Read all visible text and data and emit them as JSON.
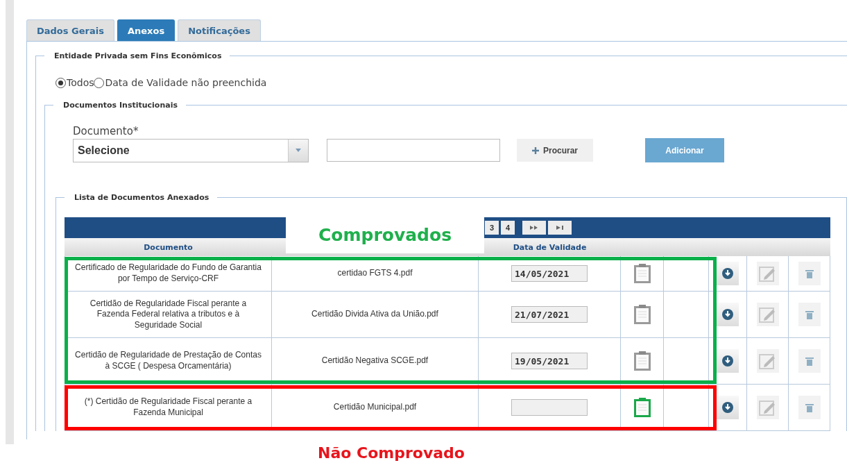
{
  "tabs": [
    {
      "label": "Dados Gerais",
      "selected": false
    },
    {
      "label": "Anexos",
      "selected": true
    },
    {
      "label": "Notificações",
      "selected": false
    }
  ],
  "entity_section": {
    "title": "Entidade Privada sem Fins Econômicos",
    "filter": [
      {
        "label": "Todos",
        "selected": true
      },
      {
        "label": "Data de Validade não preenchida",
        "selected": false
      }
    ]
  },
  "documents_section": {
    "title": "Documentos Institucionais",
    "document_label": "Documento*",
    "document_select": "Selecione",
    "browse_button": "Procurar",
    "add_button": "Adicionar"
  },
  "list_section": {
    "title": "Lista de Documentos Anexados",
    "pager": [
      "3",
      "4"
    ],
    "columns": [
      "Documento",
      "Data de Validade"
    ],
    "rows": [
      {
        "document": "Certificado de Regularidade do Fundo de Garantia por Tempo de Serviço-CRF",
        "file": "certidao FGTS 4.pdf",
        "date": "14/05/2021",
        "proven": true
      },
      {
        "document": "Certidão de Regularidade Fiscal perante a Fazenda Federal relativa a tributos e à Seguridade Social",
        "file": "Certidão Divida Ativa da União.pdf",
        "date": "21/07/2021",
        "proven": true
      },
      {
        "document": "Certidão de Regularidade de Prestação de Contas à SCGE ( Despesa Orcamentária)",
        "file": "Certidão Negativa SCGE.pdf",
        "date": "19/05/2021",
        "proven": true
      },
      {
        "document": "(*) Certidão de Regularidade Fiscal perante a Fazenda Municipal",
        "file": "Certidão Municipal.pdf",
        "proven": false
      }
    ]
  },
  "annotations": [
    {
      "kind": "proven",
      "label": "Comprovados"
    },
    {
      "kind": "unproven",
      "label": "Não Comprovado"
    }
  ]
}
